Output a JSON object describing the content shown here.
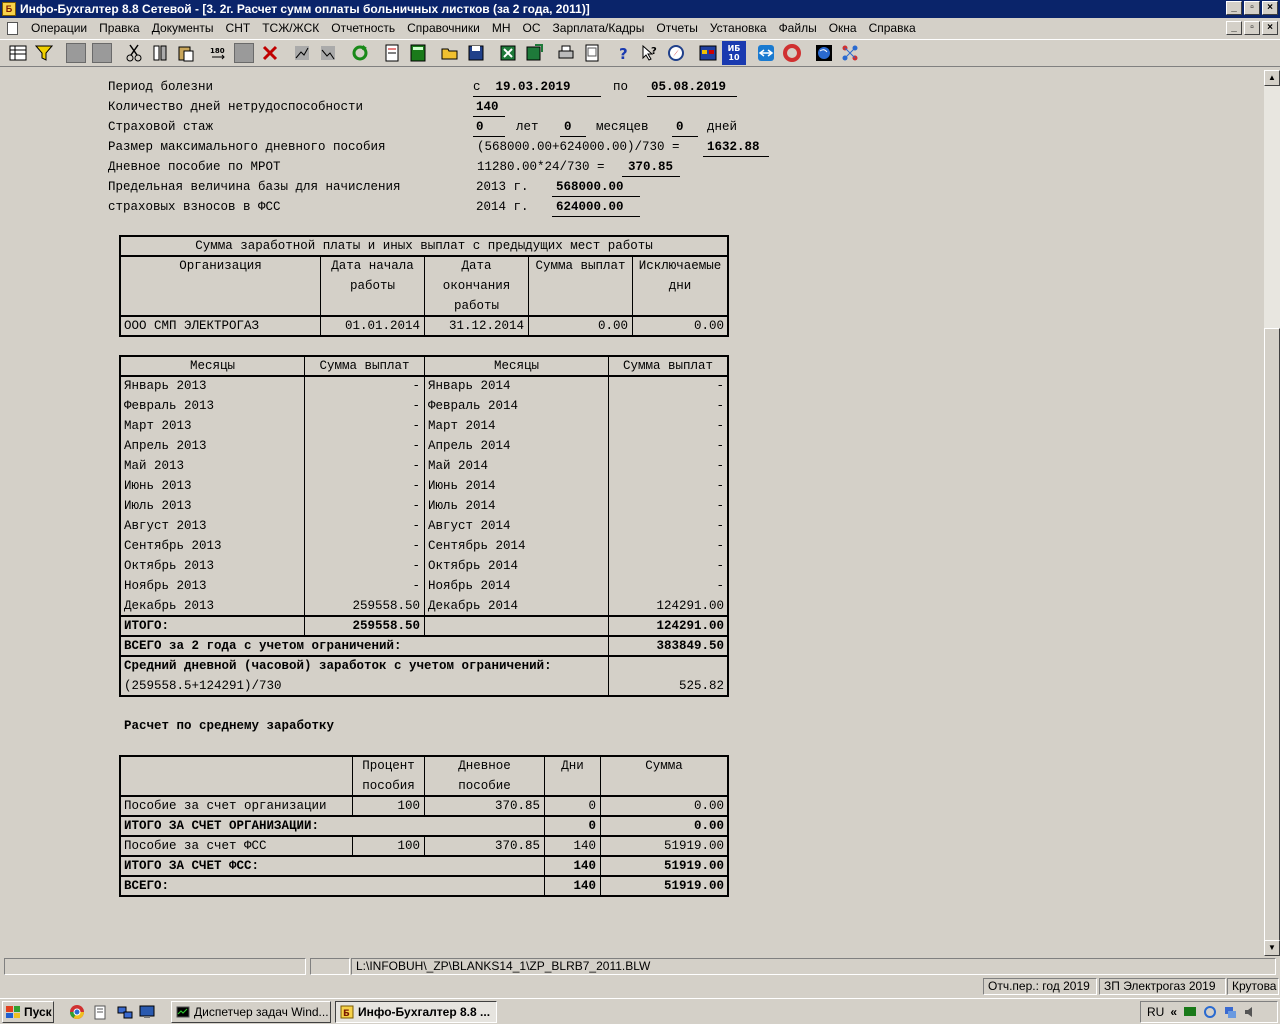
{
  "window": {
    "title": "Инфо-Бухгалтер 8.8 Сетевой - [3. 2г. Расчет сумм оплаты больничных листков (за 2 года, 2011)]",
    "controls": [
      "_",
      "▫",
      "×"
    ]
  },
  "menu": [
    "Операции",
    "Правка",
    "Документы",
    "СНТ",
    "ТСЖ/ЖСК",
    "Отчетность",
    "Справочники",
    "МН",
    "ОС",
    "Зарплата/Кадры",
    "Отчеты",
    "Установка",
    "Файлы",
    "Окна",
    "Справка"
  ],
  "toolbar": {
    "icons": [
      "grid-icon",
      "filter-icon",
      "blank-icon",
      "blank-icon",
      "cut-icon",
      "swap-icon",
      "paste-icon",
      "rotate-180-icon",
      "blank-icon",
      "delete-icon",
      "chart-icon",
      "chart-icon",
      "refresh-icon",
      "document-icon",
      "calculator-icon",
      "open-folder-icon",
      "save-icon",
      "excel-icon",
      "excel-export-icon",
      "print-icon",
      "preview-icon",
      "help-icon",
      "context-help-icon",
      "compass-icon",
      "calendar-icon",
      "ib10-icon",
      "teamviewer-icon",
      "lifebuoy-icon",
      "globe-icon",
      "network-icon"
    ],
    "ib10_label": "ИБ\n10"
  },
  "header": {
    "period_label": "Период болезни",
    "period_from_prefix": "с",
    "period_from": "19.03.2019",
    "period_to_prefix": "по",
    "period_to": "05.08.2019",
    "days_label": "Количество дней нетрудоспособности",
    "days_value": "140",
    "stazh_label": "Страховой стаж",
    "stazh_years": "0",
    "stazh_years_unit": "лет",
    "stazh_months": "0",
    "stazh_months_unit": "месяцев",
    "stazh_days": "0",
    "stazh_days_unit": "дней",
    "max_label": "Размер максимального дневного пособия",
    "max_formula": "(568000.00+624000.00)/730 =",
    "max_value": "1632.88",
    "mrot_label": "Дневное пособие по МРОТ",
    "mrot_formula": "11280.00*24/730 =",
    "mrot_value": "370.85",
    "limit_label_1": "Предельная величина базы для начисления",
    "limit_label_2": "страховых взносов в ФСС",
    "limit_year_1": "2013 г.",
    "limit_value_1": "568000.00",
    "limit_year_2": "2014 г.",
    "limit_value_2": "624000.00"
  },
  "prev_jobs": {
    "title": "Сумма заработной платы и иных выплат с предыдущих мест работы",
    "col_org": "Организация",
    "col_start": [
      "Дата начала",
      "работы"
    ],
    "col_end": [
      "Дата",
      "окончания",
      "работы"
    ],
    "col_sum": "Сумма выплат",
    "col_excl": [
      "Исключаемые",
      "дни"
    ],
    "row": {
      "org": "ООО СМП ЭЛЕКТРОГАЗ",
      "start": "01.01.2014",
      "end": "31.12.2014",
      "sum": "0.00",
      "excl": "0.00"
    }
  },
  "months_table": {
    "col_month": "Месяцы",
    "col_sum": "Сумма выплат",
    "rows": [
      [
        "Январь 2013",
        "-",
        "Январь 2014",
        "-"
      ],
      [
        "Февраль 2013",
        "-",
        "Февраль 2014",
        "-"
      ],
      [
        "Март 2013",
        "-",
        "Март 2014",
        "-"
      ],
      [
        "Апрель 2013",
        "-",
        "Апрель 2014",
        "-"
      ],
      [
        "Май 2013",
        "-",
        "Май 2014",
        "-"
      ],
      [
        "Июнь 2013",
        "-",
        "Июнь 2014",
        "-"
      ],
      [
        "Июль 2013",
        "-",
        "Июль 2014",
        "-"
      ],
      [
        "Август 2013",
        "-",
        "Август 2014",
        "-"
      ],
      [
        "Сентябрь 2013",
        "-",
        "Сентябрь 2014",
        "-"
      ],
      [
        "Октябрь 2013",
        "-",
        "Октябрь 2014",
        "-"
      ],
      [
        "Ноябрь 2013",
        "-",
        "Ноябрь 2014",
        "-"
      ],
      [
        "Декабрь 2013",
        "259558.50",
        "Декабрь 2014",
        "124291.00"
      ]
    ],
    "total_label": "ИТОГО:",
    "total_1": "259558.50",
    "total_2": "124291.00",
    "all_label": "ВСЕГО за 2 года с учетом ограничений:",
    "all_value": "383849.50",
    "avg_label": "Средний дневной (часовой) заработок с учетом ограничений:",
    "avg_formula": "(259558.5+124291)/730",
    "avg_value": "525.82"
  },
  "calc_title": "Расчет по среднему заработку",
  "calc_table": {
    "col_pct": [
      "Процент",
      "пособия"
    ],
    "col_daily": [
      "Дневное",
      "пособие"
    ],
    "col_days": "Дни",
    "col_sum": "Сумма",
    "rows": [
      {
        "label": "Пособие за счет организации",
        "pct": "100",
        "daily": "370.85",
        "days": "0",
        "sum": "0.00",
        "bold": false
      },
      {
        "label": "ИТОГО ЗА СЧЕТ ОРГАНИЗАЦИИ:",
        "pct": "",
        "daily": "",
        "days": "0",
        "sum": "0.00",
        "bold": true
      },
      {
        "label": "Пособие за счет ФСС",
        "pct": "100",
        "daily": "370.85",
        "days": "140",
        "sum": "51919.00",
        "bold": false
      },
      {
        "label": "ИТОГО ЗА СЧЕТ ФСС:",
        "pct": "",
        "daily": "",
        "days": "140",
        "sum": "51919.00",
        "bold": true
      },
      {
        "label": "ВСЕГО:",
        "pct": "",
        "daily": "",
        "days": "140",
        "sum": "51919.00",
        "bold": true
      }
    ]
  },
  "status": {
    "path": "L:\\INFOBUH\\_ZP\\BLANKS14_1\\ZP_BLRB7_2011.BLW",
    "period": "Отч.пер.: год 2019",
    "company": "ЗП Электрогаз 2019",
    "user": "Крутова"
  },
  "taskbar": {
    "start": "Пуск",
    "tasks": [
      "Диспетчер задач Wind...",
      "Инфо-Бухгалтер 8.8 ..."
    ],
    "lang": "RU",
    "tray_expand": "«"
  }
}
